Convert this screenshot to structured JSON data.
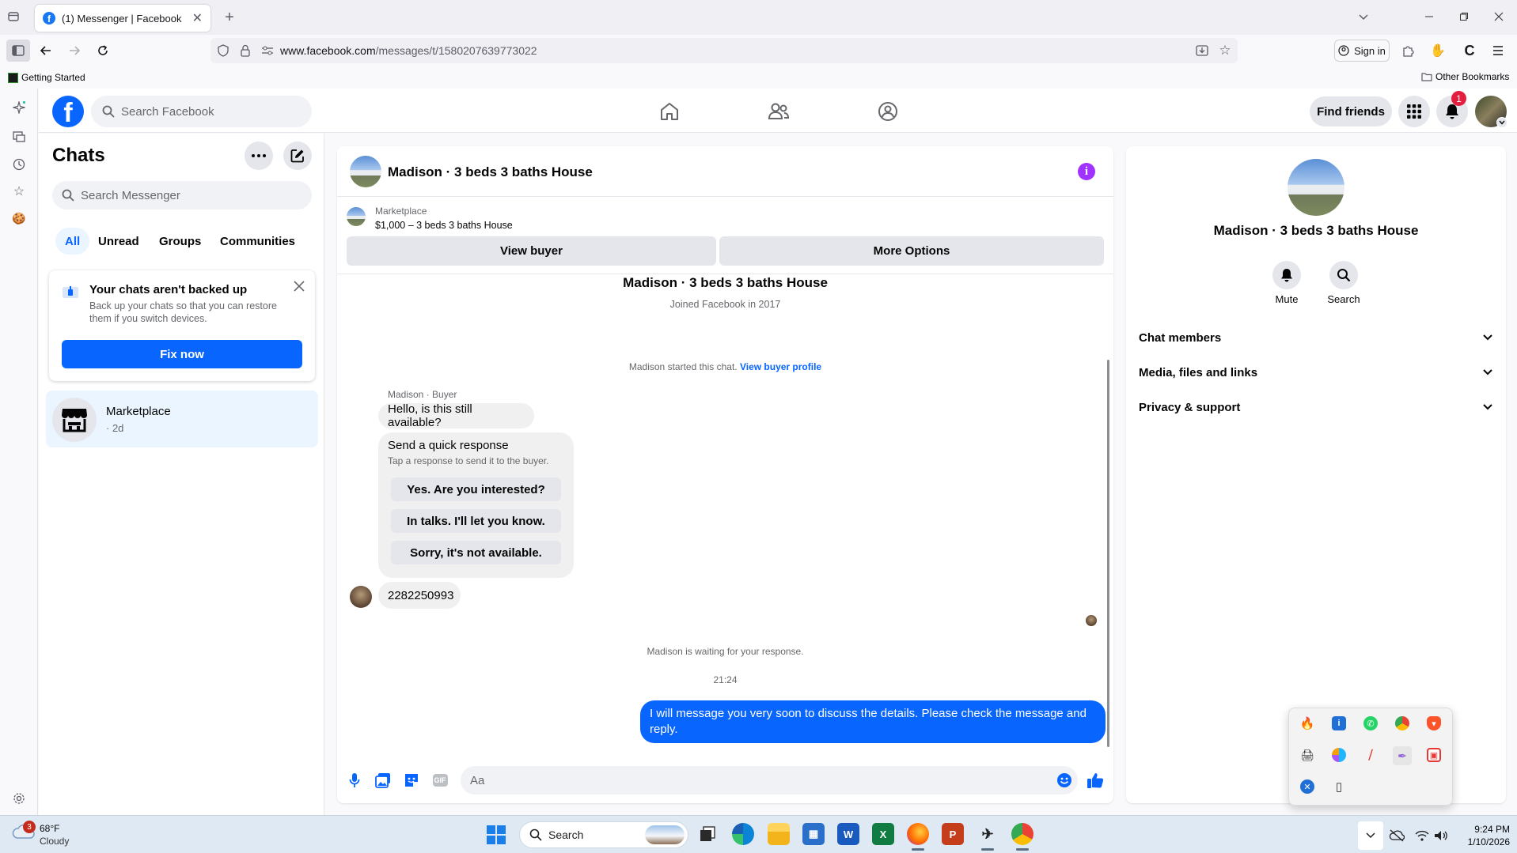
{
  "browser": {
    "tab_title": "(1) Messenger | Facebook",
    "url_domain": "www.facebook.com",
    "url_path": "/messages/t/1580207639773022",
    "sign_in_label": "Sign in",
    "bookmark_getting_started": "Getting Started",
    "bookmark_other": "Other Bookmarks"
  },
  "fb_header": {
    "logo_letter": "f",
    "search_placeholder": "Search Facebook",
    "find_friends_label": "Find friends",
    "notification_count": "1"
  },
  "chats_panel": {
    "title": "Chats",
    "search_placeholder": "Search Messenger",
    "filters": [
      {
        "label": "All",
        "active": true
      },
      {
        "label": "Unread",
        "active": false
      },
      {
        "label": "Groups",
        "active": false
      },
      {
        "label": "Communities",
        "active": false
      }
    ],
    "backup_card": {
      "title": "Your chats aren't backed up",
      "body": "Back up your chats so that you can restore them if you switch devices.",
      "button_label": "Fix now"
    },
    "conversation": {
      "name": "Marketplace",
      "time": "· 2d"
    }
  },
  "conversation": {
    "title": "Madison · 3 beds 3 baths House",
    "listing_source": "Marketplace",
    "listing_summary": "$1,000 – 3 beds 3 baths House",
    "view_buyer_label": "View buyer",
    "more_options_label": "More Options",
    "profile_name": "Madison · 3 beds 3 baths House",
    "joined_text": "Joined Facebook in 2017",
    "started_text": "Madison started this chat.",
    "view_buyer_profile_link": "View buyer profile",
    "sender_label": "Madison · Buyer",
    "first_message": "Hello, is this still available?",
    "quick_response": {
      "title": "Send a quick response",
      "subtitle": "Tap a response to send it to the buyer.",
      "options": [
        "Yes. Are you interested?",
        "In talks. I'll let you know.",
        "Sorry, it's not available."
      ]
    },
    "phone_message": "2282250993",
    "waiting_text": "Madison is waiting for your response.",
    "timestamp": "21:24",
    "outgoing_message": "I will message you very soon to discuss the details. Please check the message and reply.",
    "composer_placeholder": "Aa",
    "gif_label": "GIF"
  },
  "details_panel": {
    "name": "Madison · 3 beds 3 baths House",
    "mute_label": "Mute",
    "search_label": "Search",
    "sections": [
      "Chat members",
      "Media, files and links",
      "Privacy & support"
    ]
  },
  "taskbar": {
    "weather_temp": "68°F",
    "weather_desc": "Cloudy",
    "weather_badge": "3",
    "search_label": "Search",
    "time": "9:24 PM",
    "date": "1/10/2026"
  },
  "colors": {
    "fb_blue": "#0866ff",
    "info_purple": "#a033ff",
    "notif_red": "#e41e3f"
  }
}
